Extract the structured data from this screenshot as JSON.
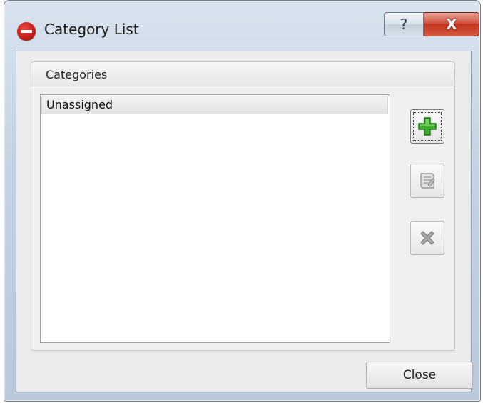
{
  "window": {
    "title": "Category List",
    "help_glyph": "?",
    "close_glyph": "X",
    "app_icon": "hilti-logo-icon"
  },
  "group": {
    "title": "Categories"
  },
  "list": {
    "items": [
      "Unassigned"
    ],
    "selected_index": 0
  },
  "toolbar": {
    "add_icon": "green-plus-icon",
    "edit_icon": "edit-note-icon",
    "delete_icon": "gray-x-icon",
    "add_enabled": true,
    "edit_enabled": false,
    "delete_enabled": false
  },
  "footer": {
    "close_label": "Close"
  },
  "colors": {
    "add_green": "#3cae2a",
    "disabled_gray": "#9a9a9a",
    "close_red": "#c2321d"
  }
}
